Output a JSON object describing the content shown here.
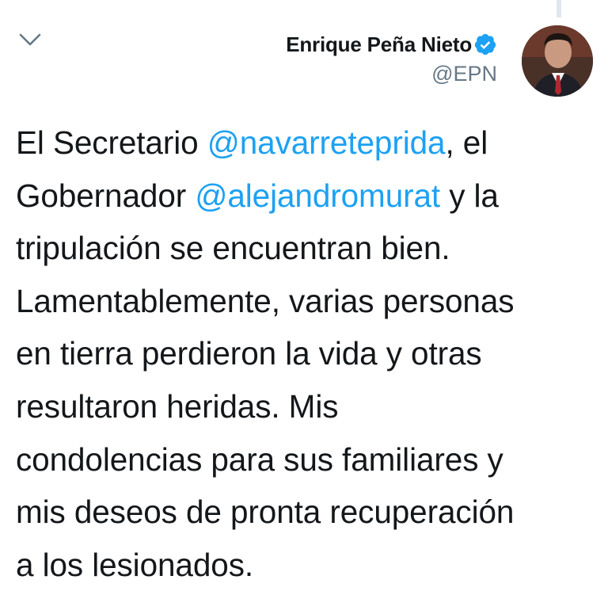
{
  "tweet": {
    "author": {
      "display_name": "Enrique Peña Nieto",
      "handle": "@EPN",
      "verified": true,
      "avatar_icon": "profile-photo"
    },
    "menu_icon": "chevron-down-icon",
    "text_lines": [
      [
        {
          "text": "El Secretario ",
          "type": "text"
        },
        {
          "text": "@navarreteprida",
          "type": "mention"
        },
        {
          "text": ", el",
          "type": "text"
        }
      ],
      [
        {
          "text": "Gobernador ",
          "type": "text"
        },
        {
          "text": "@alejandromurat",
          "type": "mention"
        },
        {
          "text": " y la",
          "type": "text"
        }
      ],
      [
        {
          "text": "tripulación se encuentran bien.",
          "type": "text"
        }
      ],
      [
        {
          "text": "Lamentablemente, varias personas",
          "type": "text"
        }
      ],
      [
        {
          "text": "en tierra perdieron la vida y otras",
          "type": "text"
        }
      ],
      [
        {
          "text": "resultaron heridas. Mis",
          "type": "text"
        }
      ],
      [
        {
          "text": "condolencias para sus familiares y",
          "type": "text"
        }
      ],
      [
        {
          "text": "mis deseos de pronta recuperación",
          "type": "text"
        }
      ],
      [
        {
          "text": "a los lesionados.",
          "type": "text"
        }
      ]
    ]
  },
  "colors": {
    "mention": "#1da1f2",
    "text": "#14171a",
    "handle": "#657786",
    "verified_badge": "#1da1f2",
    "chevron": "#657786"
  }
}
